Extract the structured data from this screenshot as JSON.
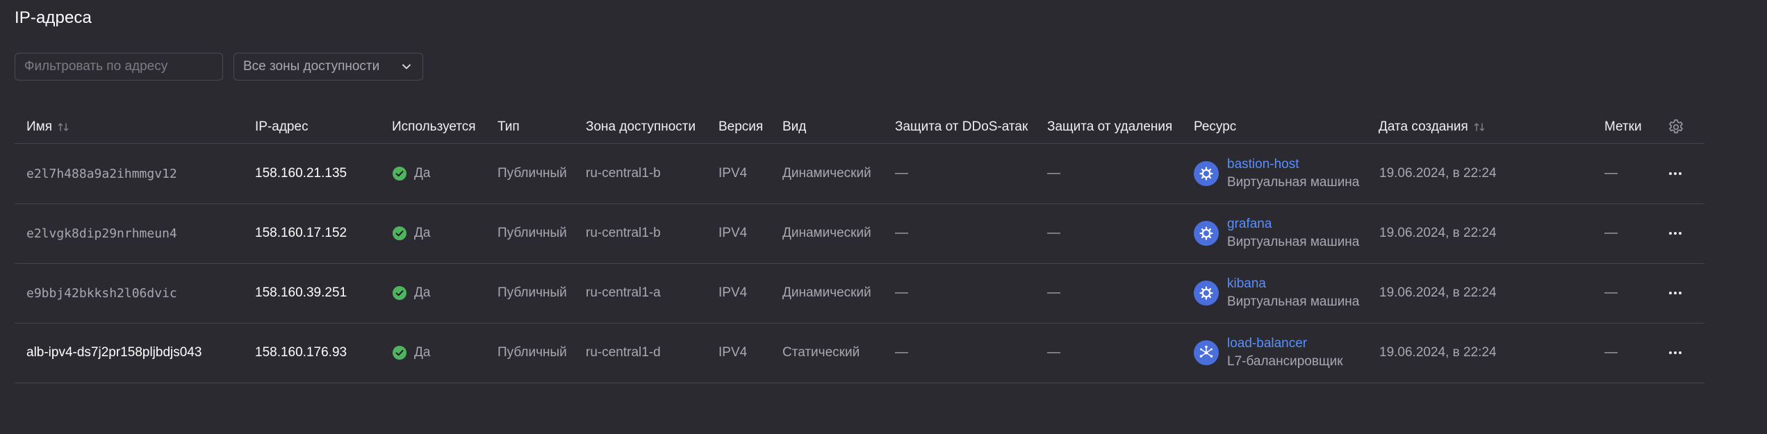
{
  "page": {
    "title": "IP-адреса"
  },
  "filters": {
    "address_placeholder": "Фильтровать по адресу",
    "address_value": "",
    "zone_selected": "Все зоны доступности"
  },
  "columns": {
    "name": "Имя",
    "ip": "IP-адрес",
    "used": "Используется",
    "type": "Тип",
    "zone": "Зона доступности",
    "version": "Версия",
    "kind": "Вид",
    "ddos": "Защита от DDoS-атак",
    "deletion": "Защита от удаления",
    "resource": "Ресурс",
    "created": "Дата создания",
    "labels": "Метки"
  },
  "rows": [
    {
      "name": "e2l7h488a9a2ihmmgv12",
      "name_mono": true,
      "ip": "158.160.21.135",
      "used": "Да",
      "type": "Публичный",
      "zone": "ru-central1-b",
      "version": "IPV4",
      "kind": "Динамический",
      "ddos": "—",
      "deletion": "—",
      "resource_name": "bastion-host",
      "resource_type": "Виртуальная машина",
      "resource_icon": "vm-icon",
      "created": "19.06.2024, в 22:24",
      "labels": "—"
    },
    {
      "name": "e2lvgk8dip29nrhmeun4",
      "name_mono": true,
      "ip": "158.160.17.152",
      "used": "Да",
      "type": "Публичный",
      "zone": "ru-central1-b",
      "version": "IPV4",
      "kind": "Динамический",
      "ddos": "—",
      "deletion": "—",
      "resource_name": "grafana",
      "resource_type": "Виртуальная машина",
      "resource_icon": "vm-icon",
      "created": "19.06.2024, в 22:24",
      "labels": "—"
    },
    {
      "name": "e9bbj42bkksh2l06dvic",
      "name_mono": true,
      "ip": "158.160.39.251",
      "used": "Да",
      "type": "Публичный",
      "zone": "ru-central1-a",
      "version": "IPV4",
      "kind": "Динамический",
      "ddos": "—",
      "deletion": "—",
      "resource_name": "kibana",
      "resource_type": "Виртуальная машина",
      "resource_icon": "vm-icon",
      "created": "19.06.2024, в 22:24",
      "labels": "—"
    },
    {
      "name": "alb-ipv4-ds7j2pr158pljbdjs043",
      "name_mono": false,
      "ip": "158.160.176.93",
      "used": "Да",
      "type": "Публичный",
      "zone": "ru-central1-d",
      "version": "IPV4",
      "kind": "Статический",
      "ddos": "—",
      "deletion": "—",
      "resource_name": "load-balancer",
      "resource_type": "L7-балансировщик",
      "resource_icon": "load-balancer-icon",
      "created": "19.06.2024, в 22:24",
      "labels": "—"
    }
  ],
  "colors": {
    "background": "#2b2a30",
    "link": "#5b8ff9",
    "success": "#4fb360",
    "resource_icon_bg": "#4a6fdc",
    "muted_text": "#a9a8b0"
  }
}
